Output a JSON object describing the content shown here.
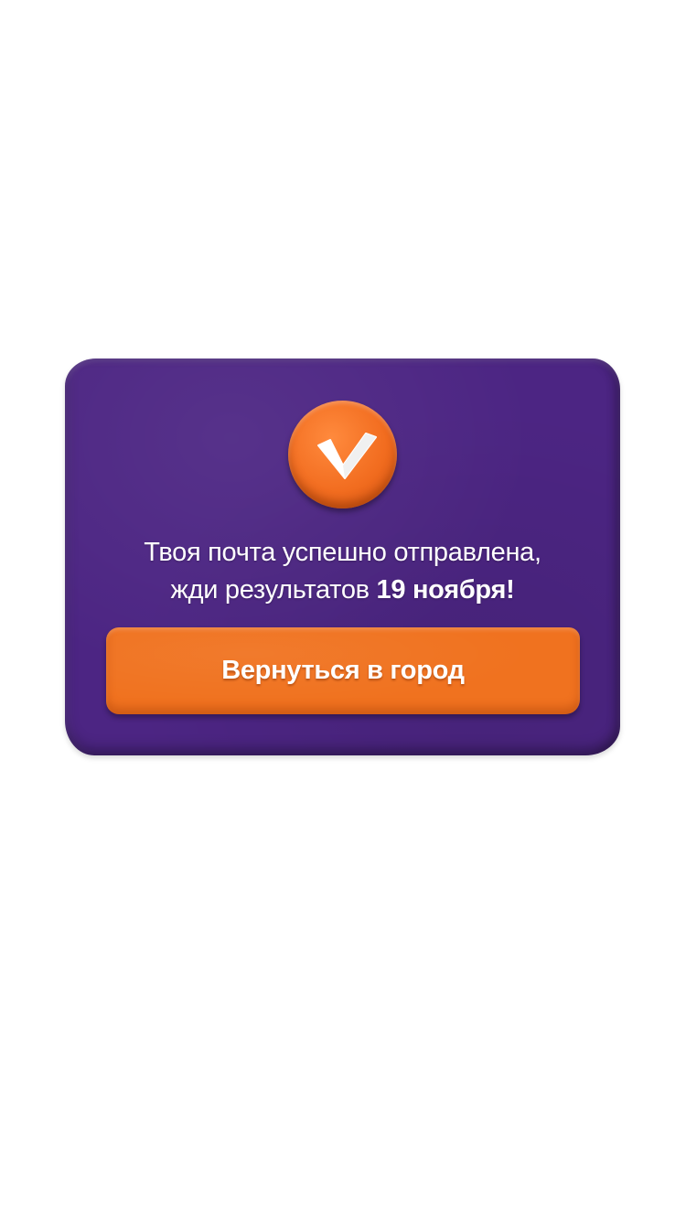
{
  "colors": {
    "background": "#ffffff",
    "card": "#4c2583",
    "accent": "#f0721f",
    "text": "#ffffff"
  },
  "dialog": {
    "icon": "checkmark-icon",
    "message_line1": "Твоя почта успешно отправлена,",
    "message_line2_prefix": "жди результатов ",
    "message_line2_bold": "19 ноября!",
    "button_label": "Вернуться в город"
  }
}
